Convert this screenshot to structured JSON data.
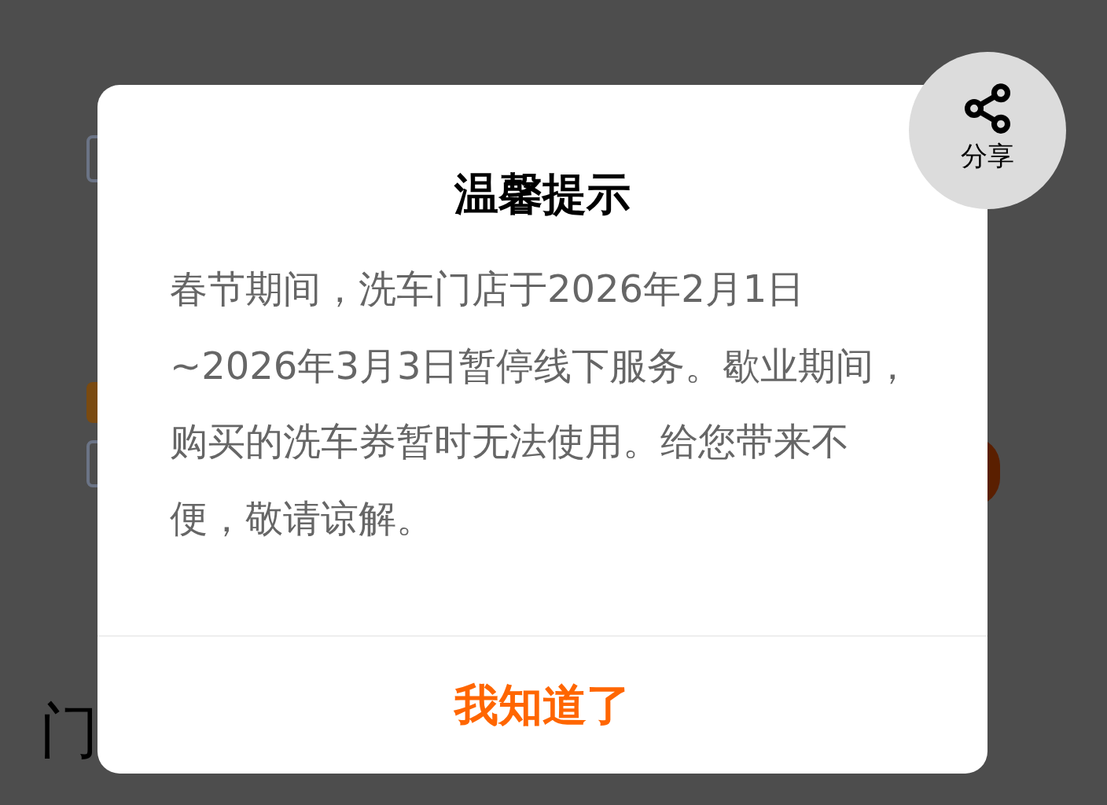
{
  "background": {
    "section_heading": "门"
  },
  "dialog": {
    "title": "温馨提示",
    "message": "春节期间，洗车门店于2026年2月1日~2026年3月3日暂停线下服务。歇业期间，购买的洗车券暂时无法使用。给您带来不便，敬请谅解。",
    "confirm_button": "我知道了"
  },
  "share_button": {
    "label": "分享"
  }
}
